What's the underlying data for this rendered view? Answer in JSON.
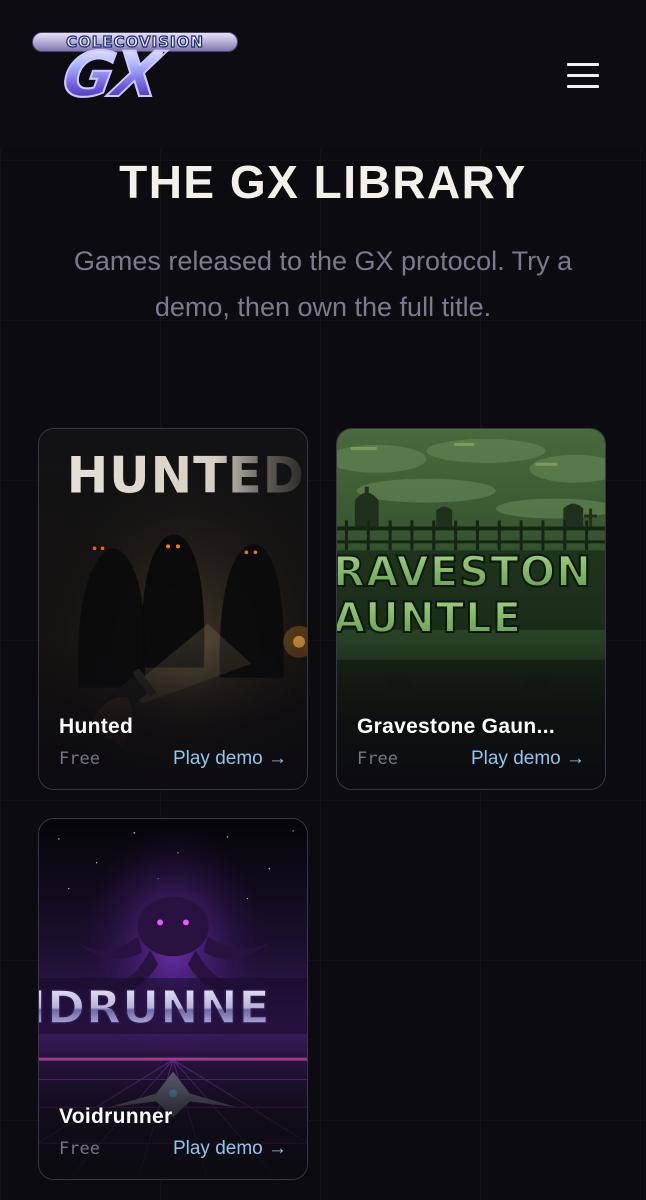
{
  "header": {
    "logo_brand": "COLECOVISION",
    "logo_mark": "GX",
    "menu_icon": "hamburger-menu-icon"
  },
  "page": {
    "title": "THE GX LIBRARY",
    "subtitle": "Games released to the GX protocol. Try a demo, then own the full title."
  },
  "games": [
    {
      "name": "Hunted",
      "art_title": "HUNTED",
      "price": "Free",
      "demo_label": "Play demo →"
    },
    {
      "name": "Gravestone Gaun...",
      "art_title_line1": "RAVESTON",
      "art_title_line2": "AUNTLE",
      "price": "Free",
      "demo_label": "Play demo →"
    },
    {
      "name": "Voidrunner",
      "art_title": "IDRUNNE",
      "price": "Free",
      "demo_label": "Play demo →"
    }
  ],
  "colors": {
    "background": "#0c0b10",
    "title": "#f4f1ea",
    "subtitle": "#7d7a8f",
    "link": "#8fc6ef",
    "price": "#767485",
    "card_border": "#3a3848"
  }
}
